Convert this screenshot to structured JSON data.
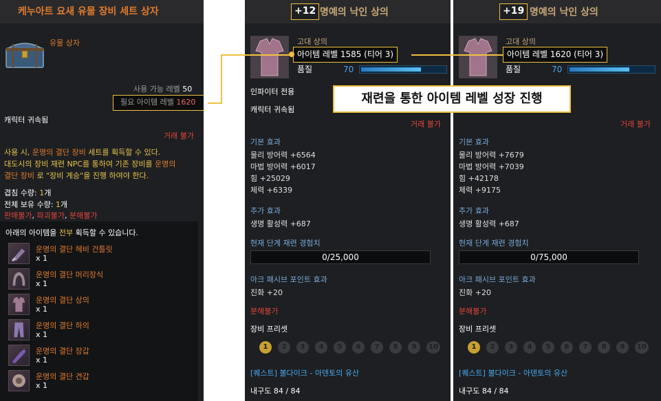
{
  "left": {
    "title": "케누아트 요새 유물 장비 세트 상자",
    "item_type": "유물 상자",
    "usable_level_label": "사용 가능 레벨",
    "usable_level_value": "50",
    "required_ilvl_label": "필요 아이템 레벨",
    "required_ilvl_value": "1620",
    "bound": "캐릭터 귀속됨",
    "trade": "거래 불가",
    "desc_line1_a": "사용 시, ",
    "desc_line1_b": "운명의 결단 장비",
    "desc_line1_c": " 세트를 획득할 수 있다.",
    "desc_line2_a": "대도시의 장비 재련 NPC를 통하여 기존 장비를 ",
    "desc_line2_b": "운명의",
    "desc_line3_a": "결단 장비",
    "desc_line3_b": " 로 \"장비 계승\"을 진행 하여야 한다.",
    "stack_label": "겹침 수량: ",
    "stack_value": "1",
    "stack_unit": "개",
    "owned_label": "전체 보유 수량: ",
    "owned_value": "1",
    "owned_unit": "개",
    "restrict_1": "판매불가",
    "restrict_sep": ", ",
    "restrict_2": "파괴불가",
    "restrict_3": "분해불가",
    "obtain_a": "아래의 아이템을 ",
    "obtain_b": "전부",
    "obtain_c": " 획득할 수 있습니다.",
    "items": [
      {
        "name": "운명의 결단 헤비 건틀릿",
        "qty": "x 1"
      },
      {
        "name": "운명의 결단 머리장식",
        "qty": "x 1"
      },
      {
        "name": "운명의 결단 상의",
        "qty": "x 1"
      },
      {
        "name": "운명의 결단 하의",
        "qty": "x 1"
      },
      {
        "name": "운명의 결단 장갑",
        "qty": "x 1"
      },
      {
        "name": "운명의 결단 견갑",
        "qty": "x 1"
      }
    ]
  },
  "mid": {
    "enhance": "+12",
    "name": "명예의 낙인 상의",
    "slot": "고대 상의",
    "ilvl": "아이템 레벨 1585 (티어 3)",
    "quality_label": "품질",
    "quality_value": "70",
    "quality_fraction": 0.7,
    "class_only": "인파이터 전용",
    "bound": "캐릭터 귀속됨",
    "trade": "거래 불가",
    "base_title": "기본 효과",
    "base_stats": [
      "물리 방어력 +6564",
      "마법 방어력 +6017",
      "힘 +25029",
      "체력 +6339"
    ],
    "extra_title": "추가 효과",
    "extra_stat": "생명 활성력 +687",
    "exp_title": "현재 단계 재련 경험치",
    "exp_value": "0/25,000",
    "ark_title": "아크 패시브 포인트 효과",
    "ark_stat": "진화 +20",
    "disassemble": "분해불가",
    "preset_title": "장비 프리셋",
    "quest": "[퀘스트] 볼다이크 - 아덴토의 유산",
    "durability": "내구도 84 / 84"
  },
  "right": {
    "enhance": "+19",
    "name": "명예의 낙인 상의",
    "slot": "고대 상의",
    "ilvl": "아이템 레벨 1620 (티어 3)",
    "quality_label": "품질",
    "quality_value": "70",
    "quality_fraction": 0.7,
    "trade": "거래 불가",
    "base_title": "기본 효과",
    "base_stats": [
      "물리 방어력 +7679",
      "마법 방어력 +7039",
      "힘 +42178",
      "체력 +9175"
    ],
    "extra_title": "추가 효과",
    "extra_stat": "생명 활성력 +687",
    "exp_title": "현재 단계 재련 경험치",
    "exp_value": "0/75,000",
    "ark_title": "아크 패시브 포인트 효과",
    "ark_stat": "진화 +20",
    "disassemble": "분해불가",
    "preset_title": "장비 프리셋",
    "quest": "[퀘스트] 볼다이크 - 아덴토의 유산",
    "durability": "내구도 84 / 84"
  },
  "presets": [
    "1",
    "2",
    "3",
    "4",
    "5",
    "6",
    "7",
    "8",
    "9",
    "10"
  ],
  "callout": "재련을 통한 아이템 레벨 성장 진행",
  "colors": {
    "accent": "#f0c040",
    "orange": "#e07b2c",
    "blue": "#4aa8f0"
  }
}
